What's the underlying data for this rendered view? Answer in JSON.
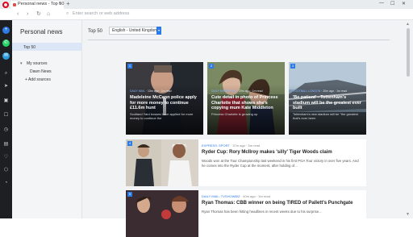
{
  "browser": {
    "tab_title": "Personal news - Top 50",
    "tab_close": "×",
    "new_tab": "+",
    "url_placeholder": "Enter search or web address",
    "nav": {
      "back": "‹",
      "forward": "›",
      "reload": "↻",
      "home": "⌂"
    },
    "window_controls": {
      "minimize": "—",
      "maximize": "☐",
      "close": "✕"
    }
  },
  "panel": {
    "title": "Personal news",
    "top": "Top 50",
    "my_sources": "My sources",
    "dawn_news": "Dawn News",
    "add_sources": "+ Add sources"
  },
  "main": {
    "label": "Top 50",
    "region": "English - United Kingdom",
    "select_arrow": "▾"
  },
  "cards": [
    {
      "num": "1",
      "source": "DAILY MAIL",
      "time": "13m ago",
      "read": "1m read",
      "title": "Madeleine McCann police apply for more money to continue £11.6m hunt",
      "desc": "Scotland Yard bosses have applied for more money to continue the"
    },
    {
      "num": "2",
      "source": "DAILY MIRROR UK",
      "time": "20m ago",
      "read": "1m read",
      "title": "Cute detail in photo of Princess Charlotte that shows she's copying mum Kate Middleton",
      "desc": "Princess Charlotte is growing up"
    },
    {
      "num": "3",
      "source": "FOOTBALL.LONDON",
      "time": "20m ago",
      "read": "1m read",
      "title": "'Be patient' - Tottenham's stadium will be the greatest ever built",
      "desc": "Tottenham's new stadium will be \"the greatest that's ever been"
    }
  ],
  "list": [
    {
      "num": "4",
      "source": "EXPRESS: SPORT",
      "time": "37m ago",
      "read": "5m read",
      "title": "Ryder Cup: Rory McIlroy makes 'silly' Tiger Woods claim",
      "desc": "Woods won at the Tour Championship last weekend in his first PGA Tour victory in over five years. And he comes into the Ryder Cup at the moment, after holding of..."
    },
    {
      "num": "5",
      "source": "DAILY MAIL: TVSHOWBIZ",
      "time": "40m ago",
      "read": "3m read",
      "title": "Ryan Thomas: CBB winner on being TIRED of Pallett's Punchgate",
      "desc": "Ryan Thomas has been hitting headlines in recent weeks due to his surprise..."
    }
  ],
  "colors": {
    "accent": "#2d7be5",
    "opera_red": "#e0001b",
    "sidebar_dark": "#1d1f23"
  }
}
